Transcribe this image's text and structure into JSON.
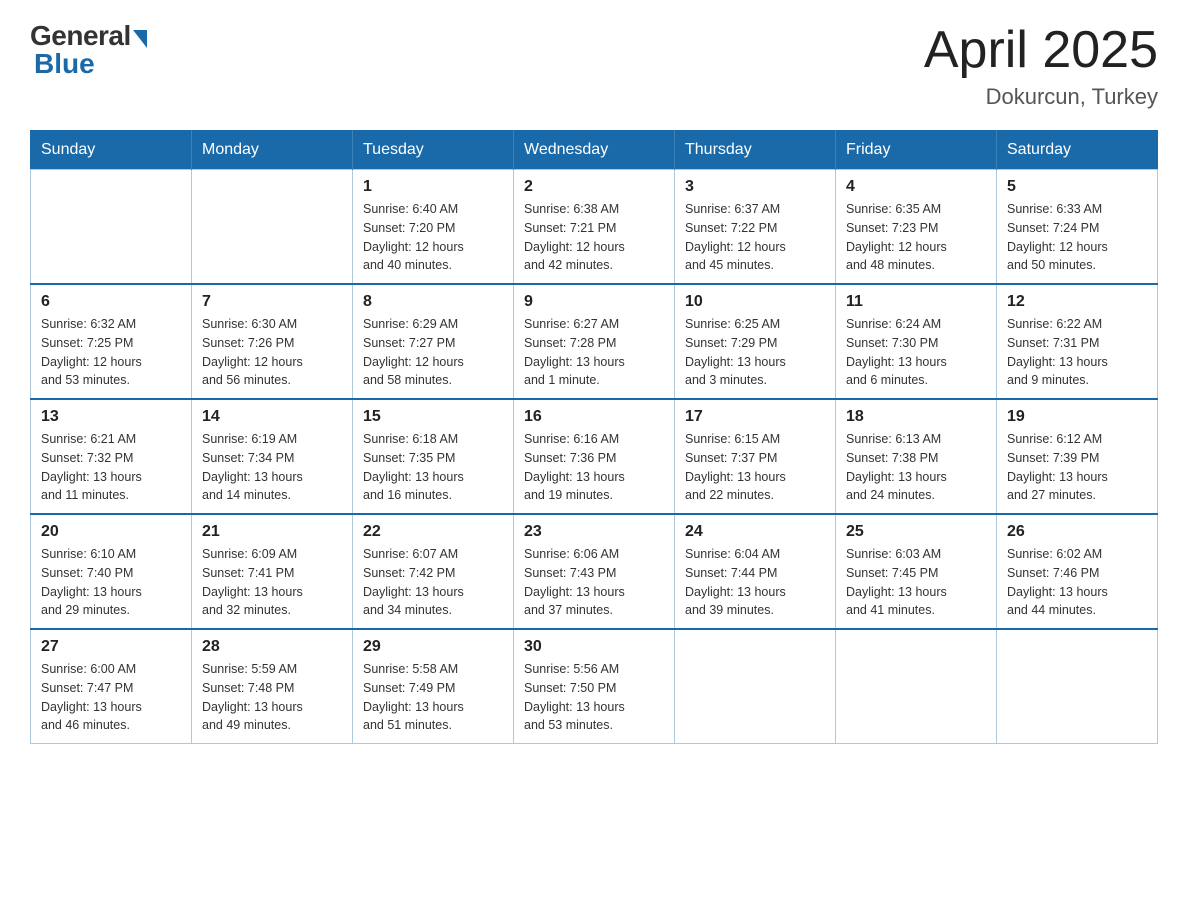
{
  "header": {
    "logo_general": "General",
    "logo_blue": "Blue",
    "month_title": "April 2025",
    "subtitle": "Dokurcun, Turkey"
  },
  "weekdays": [
    "Sunday",
    "Monday",
    "Tuesday",
    "Wednesday",
    "Thursday",
    "Friday",
    "Saturday"
  ],
  "weeks": [
    [
      {
        "day": "",
        "info": ""
      },
      {
        "day": "",
        "info": ""
      },
      {
        "day": "1",
        "info": "Sunrise: 6:40 AM\nSunset: 7:20 PM\nDaylight: 12 hours\nand 40 minutes."
      },
      {
        "day": "2",
        "info": "Sunrise: 6:38 AM\nSunset: 7:21 PM\nDaylight: 12 hours\nand 42 minutes."
      },
      {
        "day": "3",
        "info": "Sunrise: 6:37 AM\nSunset: 7:22 PM\nDaylight: 12 hours\nand 45 minutes."
      },
      {
        "day": "4",
        "info": "Sunrise: 6:35 AM\nSunset: 7:23 PM\nDaylight: 12 hours\nand 48 minutes."
      },
      {
        "day": "5",
        "info": "Sunrise: 6:33 AM\nSunset: 7:24 PM\nDaylight: 12 hours\nand 50 minutes."
      }
    ],
    [
      {
        "day": "6",
        "info": "Sunrise: 6:32 AM\nSunset: 7:25 PM\nDaylight: 12 hours\nand 53 minutes."
      },
      {
        "day": "7",
        "info": "Sunrise: 6:30 AM\nSunset: 7:26 PM\nDaylight: 12 hours\nand 56 minutes."
      },
      {
        "day": "8",
        "info": "Sunrise: 6:29 AM\nSunset: 7:27 PM\nDaylight: 12 hours\nand 58 minutes."
      },
      {
        "day": "9",
        "info": "Sunrise: 6:27 AM\nSunset: 7:28 PM\nDaylight: 13 hours\nand 1 minute."
      },
      {
        "day": "10",
        "info": "Sunrise: 6:25 AM\nSunset: 7:29 PM\nDaylight: 13 hours\nand 3 minutes."
      },
      {
        "day": "11",
        "info": "Sunrise: 6:24 AM\nSunset: 7:30 PM\nDaylight: 13 hours\nand 6 minutes."
      },
      {
        "day": "12",
        "info": "Sunrise: 6:22 AM\nSunset: 7:31 PM\nDaylight: 13 hours\nand 9 minutes."
      }
    ],
    [
      {
        "day": "13",
        "info": "Sunrise: 6:21 AM\nSunset: 7:32 PM\nDaylight: 13 hours\nand 11 minutes."
      },
      {
        "day": "14",
        "info": "Sunrise: 6:19 AM\nSunset: 7:34 PM\nDaylight: 13 hours\nand 14 minutes."
      },
      {
        "day": "15",
        "info": "Sunrise: 6:18 AM\nSunset: 7:35 PM\nDaylight: 13 hours\nand 16 minutes."
      },
      {
        "day": "16",
        "info": "Sunrise: 6:16 AM\nSunset: 7:36 PM\nDaylight: 13 hours\nand 19 minutes."
      },
      {
        "day": "17",
        "info": "Sunrise: 6:15 AM\nSunset: 7:37 PM\nDaylight: 13 hours\nand 22 minutes."
      },
      {
        "day": "18",
        "info": "Sunrise: 6:13 AM\nSunset: 7:38 PM\nDaylight: 13 hours\nand 24 minutes."
      },
      {
        "day": "19",
        "info": "Sunrise: 6:12 AM\nSunset: 7:39 PM\nDaylight: 13 hours\nand 27 minutes."
      }
    ],
    [
      {
        "day": "20",
        "info": "Sunrise: 6:10 AM\nSunset: 7:40 PM\nDaylight: 13 hours\nand 29 minutes."
      },
      {
        "day": "21",
        "info": "Sunrise: 6:09 AM\nSunset: 7:41 PM\nDaylight: 13 hours\nand 32 minutes."
      },
      {
        "day": "22",
        "info": "Sunrise: 6:07 AM\nSunset: 7:42 PM\nDaylight: 13 hours\nand 34 minutes."
      },
      {
        "day": "23",
        "info": "Sunrise: 6:06 AM\nSunset: 7:43 PM\nDaylight: 13 hours\nand 37 minutes."
      },
      {
        "day": "24",
        "info": "Sunrise: 6:04 AM\nSunset: 7:44 PM\nDaylight: 13 hours\nand 39 minutes."
      },
      {
        "day": "25",
        "info": "Sunrise: 6:03 AM\nSunset: 7:45 PM\nDaylight: 13 hours\nand 41 minutes."
      },
      {
        "day": "26",
        "info": "Sunrise: 6:02 AM\nSunset: 7:46 PM\nDaylight: 13 hours\nand 44 minutes."
      }
    ],
    [
      {
        "day": "27",
        "info": "Sunrise: 6:00 AM\nSunset: 7:47 PM\nDaylight: 13 hours\nand 46 minutes."
      },
      {
        "day": "28",
        "info": "Sunrise: 5:59 AM\nSunset: 7:48 PM\nDaylight: 13 hours\nand 49 minutes."
      },
      {
        "day": "29",
        "info": "Sunrise: 5:58 AM\nSunset: 7:49 PM\nDaylight: 13 hours\nand 51 minutes."
      },
      {
        "day": "30",
        "info": "Sunrise: 5:56 AM\nSunset: 7:50 PM\nDaylight: 13 hours\nand 53 minutes."
      },
      {
        "day": "",
        "info": ""
      },
      {
        "day": "",
        "info": ""
      },
      {
        "day": "",
        "info": ""
      }
    ]
  ]
}
